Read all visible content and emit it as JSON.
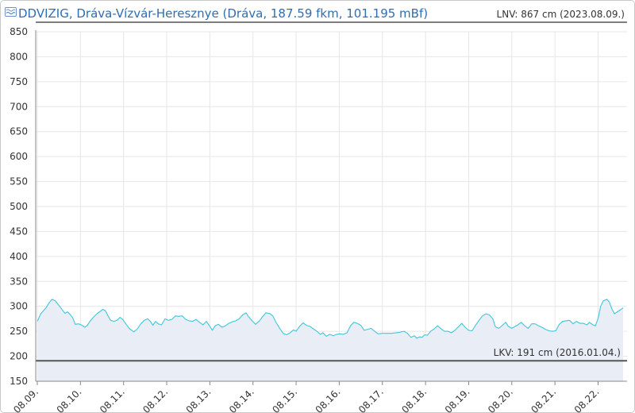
{
  "header": {
    "title": "DDVIZIG, Dráva-Vízvár-Heresznye (Dráva, 187.59 fkm, 101.195 mBf)",
    "lnv_label": "LNV: 867 cm (2023.08.09.)",
    "logo_icon": "ddvizig-logo-icon"
  },
  "chart_data": {
    "type": "area",
    "title": "DDVIZIG, Dráva-Vízvár-Heresznye (Dráva, 187.59 fkm, 101.195 mBf)",
    "xlabel": "",
    "ylabel": "",
    "ylim": [
      150,
      850
    ],
    "yticks": [
      150,
      200,
      250,
      300,
      350,
      400,
      450,
      500,
      550,
      600,
      650,
      700,
      750,
      800,
      850
    ],
    "x_categories": [
      "08.09.",
      "08.10.",
      "08.11.",
      "08.12.",
      "08.13.",
      "08.14.",
      "08.15.",
      "08.16.",
      "08.17.",
      "08.18.",
      "08.19.",
      "08.20.",
      "08.21.",
      "08.22."
    ],
    "x_domain": [
      0,
      13.58
    ],
    "grid": true,
    "series": [
      {
        "name": "",
        "color": "#3fc7db",
        "fill": "#e9edf6",
        "points": [
          [
            0.0,
            270
          ],
          [
            0.08,
            285
          ],
          [
            0.2,
            297
          ],
          [
            0.28,
            308
          ],
          [
            0.34,
            314
          ],
          [
            0.42,
            311
          ],
          [
            0.5,
            302
          ],
          [
            0.58,
            293
          ],
          [
            0.64,
            286
          ],
          [
            0.7,
            289
          ],
          [
            0.76,
            284
          ],
          [
            0.82,
            277
          ],
          [
            0.88,
            264
          ],
          [
            0.96,
            265
          ],
          [
            1.04,
            262
          ],
          [
            1.1,
            258
          ],
          [
            1.16,
            262
          ],
          [
            1.22,
            270
          ],
          [
            1.3,
            278
          ],
          [
            1.38,
            285
          ],
          [
            1.46,
            290
          ],
          [
            1.52,
            294
          ],
          [
            1.58,
            291
          ],
          [
            1.64,
            281
          ],
          [
            1.7,
            272
          ],
          [
            1.78,
            270
          ],
          [
            1.86,
            273
          ],
          [
            1.92,
            278
          ],
          [
            1.98,
            274
          ],
          [
            2.06,
            264
          ],
          [
            2.14,
            255
          ],
          [
            2.24,
            249
          ],
          [
            2.32,
            255
          ],
          [
            2.4,
            265
          ],
          [
            2.48,
            272
          ],
          [
            2.56,
            275
          ],
          [
            2.62,
            270
          ],
          [
            2.68,
            262
          ],
          [
            2.74,
            270
          ],
          [
            2.8,
            265
          ],
          [
            2.88,
            263
          ],
          [
            2.96,
            275
          ],
          [
            3.04,
            272
          ],
          [
            3.12,
            274
          ],
          [
            3.2,
            281
          ],
          [
            3.28,
            280
          ],
          [
            3.36,
            281
          ],
          [
            3.44,
            274
          ],
          [
            3.52,
            271
          ],
          [
            3.6,
            270
          ],
          [
            3.68,
            274
          ],
          [
            3.76,
            268
          ],
          [
            3.84,
            263
          ],
          [
            3.92,
            270
          ],
          [
            4.0,
            260
          ],
          [
            4.06,
            252
          ],
          [
            4.12,
            261
          ],
          [
            4.2,
            264
          ],
          [
            4.28,
            258
          ],
          [
            4.36,
            261
          ],
          [
            4.44,
            266
          ],
          [
            4.52,
            269
          ],
          [
            4.6,
            271
          ],
          [
            4.68,
            275
          ],
          [
            4.76,
            283
          ],
          [
            4.84,
            287
          ],
          [
            4.9,
            279
          ],
          [
            4.98,
            271
          ],
          [
            5.06,
            264
          ],
          [
            5.14,
            270
          ],
          [
            5.22,
            279
          ],
          [
            5.3,
            287
          ],
          [
            5.38,
            286
          ],
          [
            5.46,
            281
          ],
          [
            5.54,
            267
          ],
          [
            5.62,
            256
          ],
          [
            5.7,
            246
          ],
          [
            5.78,
            243
          ],
          [
            5.86,
            247
          ],
          [
            5.94,
            253
          ],
          [
            6.0,
            250
          ],
          [
            6.08,
            260
          ],
          [
            6.16,
            267
          ],
          [
            6.24,
            262
          ],
          [
            6.32,
            260
          ],
          [
            6.4,
            255
          ],
          [
            6.48,
            250
          ],
          [
            6.56,
            244
          ],
          [
            6.62,
            247
          ],
          [
            6.7,
            240
          ],
          [
            6.78,
            244
          ],
          [
            6.86,
            241
          ],
          [
            6.94,
            244
          ],
          [
            7.02,
            245
          ],
          [
            7.1,
            244
          ],
          [
            7.18,
            247
          ],
          [
            7.26,
            261
          ],
          [
            7.34,
            268
          ],
          [
            7.42,
            266
          ],
          [
            7.5,
            262
          ],
          [
            7.58,
            252
          ],
          [
            7.66,
            254
          ],
          [
            7.74,
            256
          ],
          [
            7.82,
            250
          ],
          [
            7.9,
            245
          ],
          [
            8.0,
            246
          ],
          [
            8.2,
            246
          ],
          [
            8.4,
            248
          ],
          [
            8.5,
            250
          ],
          [
            8.58,
            246
          ],
          [
            8.66,
            238
          ],
          [
            8.74,
            241
          ],
          [
            8.8,
            236
          ],
          [
            8.86,
            239
          ],
          [
            8.92,
            238
          ],
          [
            8.98,
            243
          ],
          [
            9.04,
            242
          ],
          [
            9.12,
            250
          ],
          [
            9.2,
            255
          ],
          [
            9.28,
            261
          ],
          [
            9.36,
            255
          ],
          [
            9.44,
            250
          ],
          [
            9.52,
            250
          ],
          [
            9.6,
            247
          ],
          [
            9.68,
            252
          ],
          [
            9.76,
            259
          ],
          [
            9.84,
            266
          ],
          [
            9.92,
            258
          ],
          [
            10.0,
            252
          ],
          [
            10.08,
            251
          ],
          [
            10.16,
            262
          ],
          [
            10.24,
            272
          ],
          [
            10.32,
            281
          ],
          [
            10.4,
            285
          ],
          [
            10.48,
            283
          ],
          [
            10.56,
            275
          ],
          [
            10.62,
            259
          ],
          [
            10.7,
            256
          ],
          [
            10.78,
            262
          ],
          [
            10.86,
            268
          ],
          [
            10.92,
            260
          ],
          [
            11.0,
            256
          ],
          [
            11.08,
            260
          ],
          [
            11.14,
            263
          ],
          [
            11.22,
            268
          ],
          [
            11.3,
            261
          ],
          [
            11.38,
            256
          ],
          [
            11.46,
            265
          ],
          [
            11.54,
            265
          ],
          [
            11.62,
            261
          ],
          [
            11.7,
            258
          ],
          [
            11.78,
            254
          ],
          [
            11.86,
            251
          ],
          [
            11.94,
            250
          ],
          [
            12.02,
            251
          ],
          [
            12.1,
            264
          ],
          [
            12.18,
            270
          ],
          [
            12.26,
            271
          ],
          [
            12.34,
            272
          ],
          [
            12.42,
            265
          ],
          [
            12.5,
            270
          ],
          [
            12.58,
            266
          ],
          [
            12.66,
            266
          ],
          [
            12.74,
            263
          ],
          [
            12.8,
            268
          ],
          [
            12.88,
            263
          ],
          [
            12.94,
            261
          ],
          [
            13.0,
            276
          ],
          [
            13.06,
            300
          ],
          [
            13.12,
            311
          ],
          [
            13.2,
            314
          ],
          [
            13.26,
            309
          ],
          [
            13.32,
            295
          ],
          [
            13.38,
            285
          ],
          [
            13.46,
            290
          ],
          [
            13.52,
            293
          ],
          [
            13.58,
            297
          ]
        ]
      }
    ],
    "reference_lines": [
      {
        "name": "LKV",
        "label": "LKV: 191 cm (2016.01.04.)",
        "value": 191,
        "color": "#555555"
      }
    ]
  }
}
